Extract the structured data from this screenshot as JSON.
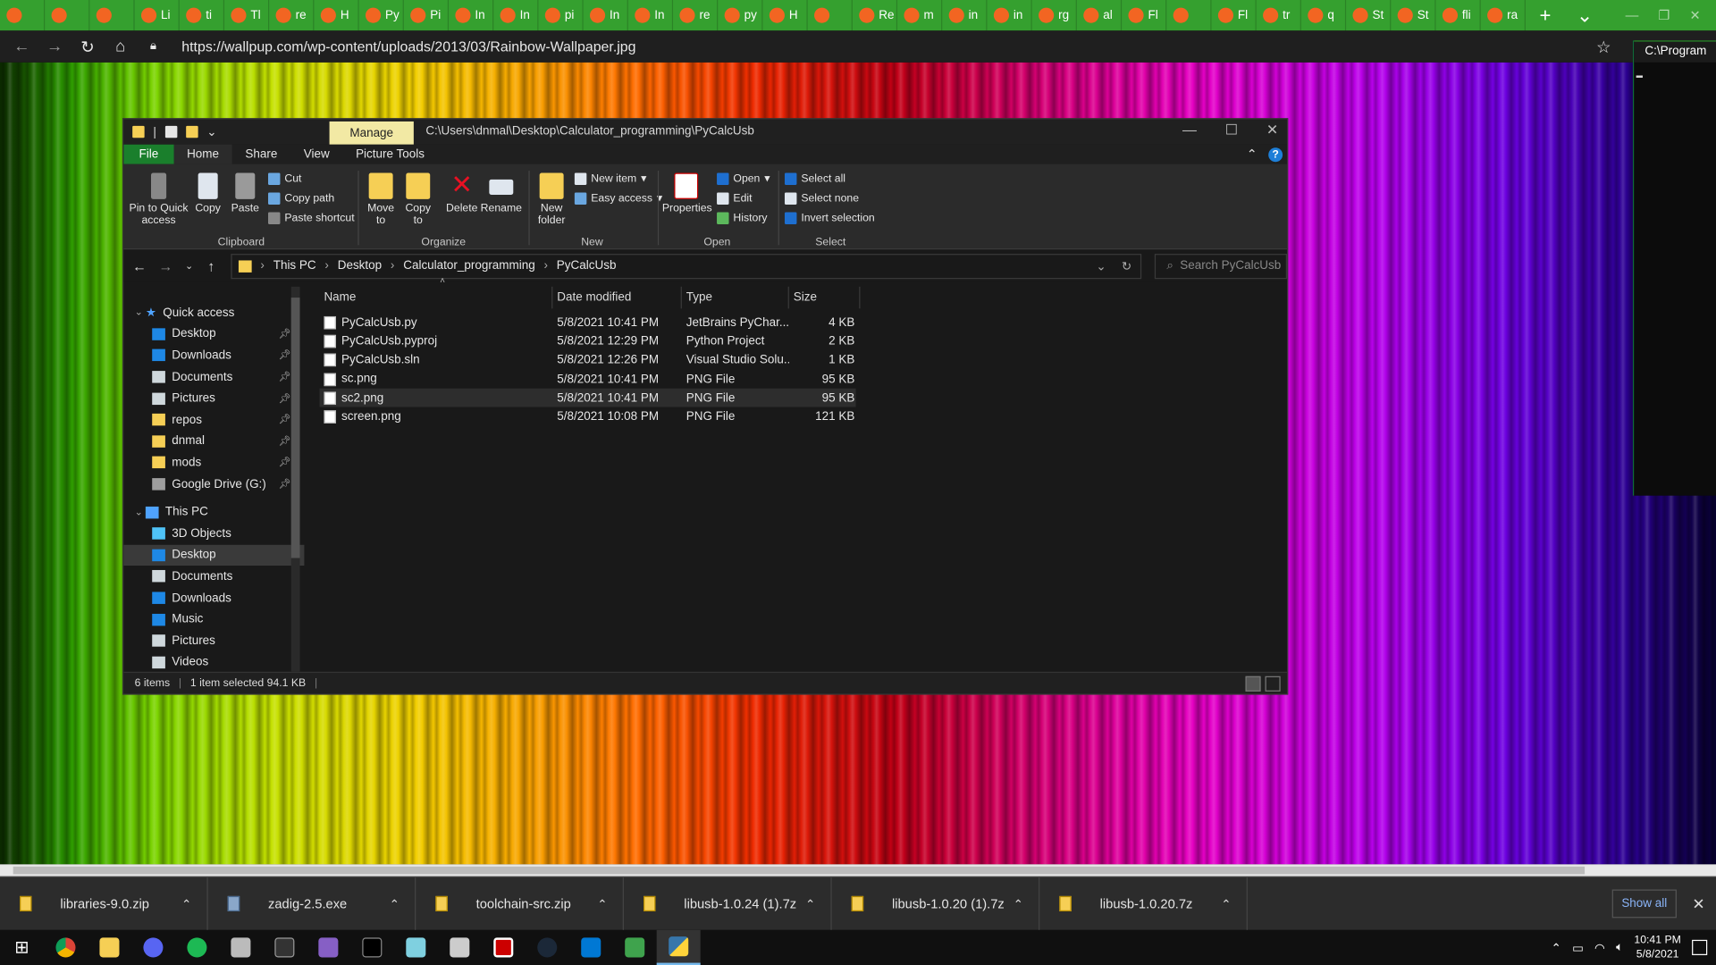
{
  "browser": {
    "tabs": [
      "",
      "",
      "",
      "Li",
      "ti",
      "Tl",
      "re",
      "H",
      "Py",
      "Pi",
      "In",
      "In",
      "pi",
      "In",
      "In",
      "re",
      "py",
      "H",
      "",
      "Re",
      "m",
      "in",
      "in",
      "rg",
      "al",
      "Fl",
      "",
      "Fl",
      "tr",
      "q",
      "St",
      "St",
      "fli",
      "ra"
    ],
    "new_tab_symbol": "+",
    "url": "https://wallpup.com/wp-content/uploads/2013/03/Rainbow-Wallpaper.jpg"
  },
  "console": {
    "title": "C:\\Program"
  },
  "explorer": {
    "manage_tab": "Manage",
    "title_path": "C:\\Users\\dnmal\\Desktop\\Calculator_programming\\PyCalcUsb",
    "ribbon_tabs": [
      "File",
      "Home",
      "Share",
      "View",
      "Picture Tools"
    ],
    "ribbon": {
      "clipboard": {
        "pin_label": "Pin to Quick access",
        "copy_label": "Copy",
        "paste_label": "Paste",
        "cut_label": "Cut",
        "copy_path_label": "Copy path",
        "paste_shortcut_label": "Paste shortcut",
        "group_label": "Clipboard"
      },
      "organize": {
        "move_label": "Move to",
        "copy_to_label": "Copy to",
        "delete_label": "Delete",
        "rename_label": "Rename",
        "group_label": "Organize"
      },
      "new": {
        "new_folder_label": "New folder",
        "new_item_label": "New item",
        "easy_access_label": "Easy access",
        "group_label": "New"
      },
      "open": {
        "properties_label": "Properties",
        "open_label": "Open",
        "edit_label": "Edit",
        "history_label": "History",
        "group_label": "Open"
      },
      "select": {
        "select_all_label": "Select all",
        "select_none_label": "Select none",
        "invert_label": "Invert selection",
        "group_label": "Select"
      }
    },
    "breadcrumb": [
      "This PC",
      "Desktop",
      "Calculator_programming",
      "PyCalcUsb"
    ],
    "search_placeholder": "Search PyCalcUsb",
    "nav": {
      "quick_access": "Quick access",
      "quick_items": [
        "Desktop",
        "Downloads",
        "Documents",
        "Pictures",
        "repos",
        "dnmal",
        "mods",
        "Google Drive (G:)"
      ],
      "this_pc": "This PC",
      "pc_items": [
        "3D Objects",
        "Desktop",
        "Documents",
        "Downloads",
        "Music",
        "Pictures",
        "Videos"
      ]
    },
    "columns": [
      "Name",
      "Date modified",
      "Type",
      "Size"
    ],
    "files": [
      {
        "name": "PyCalcUsb.py",
        "date": "5/8/2021 10:41 PM",
        "type": "JetBrains PyChar...",
        "size": "4 KB"
      },
      {
        "name": "PyCalcUsb.pyproj",
        "date": "5/8/2021 12:29 PM",
        "type": "Python Project",
        "size": "2 KB"
      },
      {
        "name": "PyCalcUsb.sln",
        "date": "5/8/2021 12:26 PM",
        "type": "Visual Studio Solu...",
        "size": "1 KB"
      },
      {
        "name": "sc.png",
        "date": "5/8/2021 10:41 PM",
        "type": "PNG File",
        "size": "95 KB"
      },
      {
        "name": "sc2.png",
        "date": "5/8/2021 10:41 PM",
        "type": "PNG File",
        "size": "95 KB"
      },
      {
        "name": "screen.png",
        "date": "5/8/2021 10:08 PM",
        "type": "PNG File",
        "size": "121 KB"
      }
    ],
    "status": {
      "items": "6 items",
      "selected": "1 item selected  94.1 KB"
    }
  },
  "downloads": {
    "items": [
      "libraries-9.0.zip",
      "zadig-2.5.exe",
      "toolchain-src.zip",
      "libusb-1.0.24 (1).7z",
      "libusb-1.0.20 (1).7z",
      "libusb-1.0.20.7z"
    ],
    "show_all": "Show all"
  },
  "taskbar": {
    "time": "10:41 PM",
    "date": "5/8/2021"
  }
}
